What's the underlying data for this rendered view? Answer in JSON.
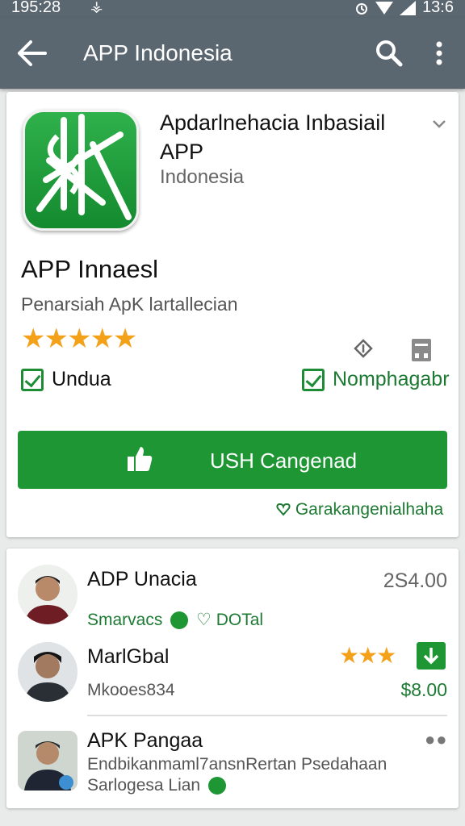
{
  "status_bar": {
    "time": "195:28",
    "notif": "⚶",
    "right": "13:6"
  },
  "app_bar": {
    "title": "APP Indonesia"
  },
  "app": {
    "top_name": "Apdarlnehacia  Inbasiail APP",
    "developer": "Indonesia",
    "main_name": "APP Innaesl",
    "subtitle": "Penarsiah  ApK lartallecian",
    "rating_stars": "★★★★★",
    "check_left": "Undua",
    "check_right": "Nomphagabr",
    "install_label": "USH Cangenad",
    "note": "Garakangenialhaha"
  },
  "list": {
    "items": [
      {
        "name": "ADP Unacia",
        "meta": "Smarvacs",
        "meta_extra": "DOTal",
        "price": "2S4.00"
      },
      {
        "name": "MarlGbal",
        "meta": "Mkooes834",
        "price": "$8.00",
        "rating_stars": "★★★"
      },
      {
        "name": "APK Pangaa",
        "meta": "Endbikanmaml7ansnRertan Psedahaan",
        "meta2": "Sarlogesa Lian"
      }
    ]
  },
  "colors": {
    "toolbar": "#5b6770",
    "accent_green": "#1e9634",
    "star": "#f4a11a"
  }
}
